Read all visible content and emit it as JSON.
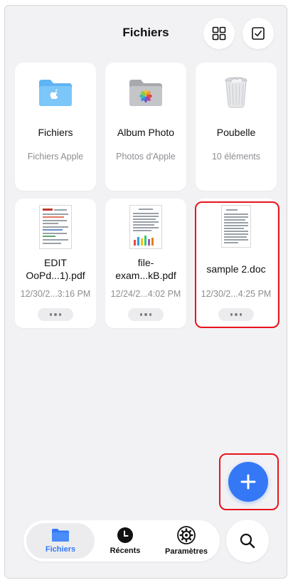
{
  "header": {
    "title": "Fichiers",
    "grid_icon": "grid-view-icon",
    "select_icon": "checkbox-select-icon"
  },
  "locations": [
    {
      "name": "Fichiers",
      "subtitle": "Fichiers Apple",
      "icon": "apple-folder-icon"
    },
    {
      "name": "Album Photo",
      "subtitle": "Photos d'Apple",
      "icon": "photos-folder-icon"
    },
    {
      "name": "Poubelle",
      "subtitle": "10 éléments",
      "icon": "trash-icon"
    }
  ],
  "files": [
    {
      "name_line1": "EDIT",
      "name_line2": "OoPd...1).pdf",
      "date": "12/30/2...3:16 PM"
    },
    {
      "name_line1": "file-",
      "name_line2": "exam...kB.pdf",
      "date": "12/24/2...4:02 PM"
    },
    {
      "name_line1": "sample 2.doc",
      "name_line2": "",
      "date": "12/30/2...4:25 PM"
    }
  ],
  "fab": {
    "icon": "plus-icon"
  },
  "tabbar": {
    "tabs": [
      {
        "label": "Fichiers",
        "icon": "folder-icon",
        "active": true
      },
      {
        "label": "Récents",
        "icon": "clock-icon",
        "active": false
      },
      {
        "label": "Paramètres",
        "icon": "gear-icon",
        "active": false
      }
    ],
    "search_icon": "search-icon"
  },
  "colors": {
    "accent": "#3478f6",
    "highlight": "#e8141c",
    "background": "#f2f2f4"
  }
}
